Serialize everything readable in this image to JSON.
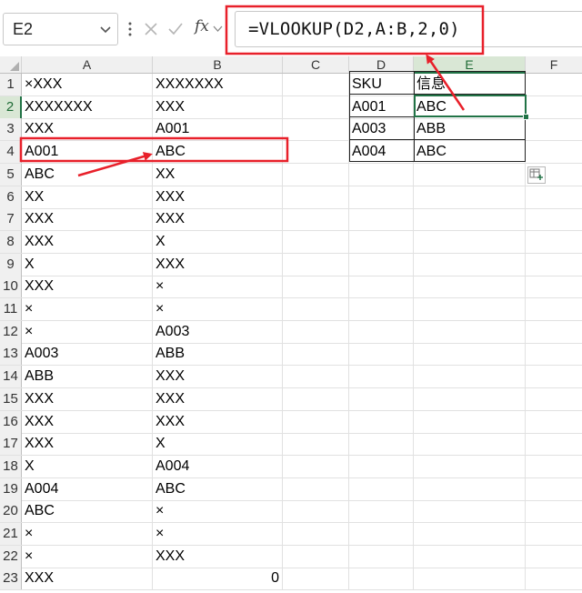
{
  "formula_bar": {
    "name_box": "E2",
    "fx_label": "fx",
    "formula": "=VLOOKUP(D2,A:B,2,0)"
  },
  "columns": [
    "A",
    "B",
    "C",
    "D",
    "E",
    "F"
  ],
  "selected_column": "E",
  "selected_row": "2",
  "rows": [
    {
      "num": "1",
      "a": "×XXX",
      "b": "XXXXXXX",
      "d": "SKU",
      "e": "信息"
    },
    {
      "num": "2",
      "a": "XXXXXXX",
      "b": "XXX",
      "d": "A001",
      "e": "ABC"
    },
    {
      "num": "3",
      "a": "XXX",
      "b": "A001",
      "d": "A003",
      "e": "ABB"
    },
    {
      "num": "4",
      "a": "A001",
      "b": "ABC",
      "d": "A004",
      "e": "ABC"
    },
    {
      "num": "5",
      "a": "ABC",
      "b": "XX"
    },
    {
      "num": "6",
      "a": "XX",
      "b": "XXX"
    },
    {
      "num": "7",
      "a": "XXX",
      "b": "XXX"
    },
    {
      "num": "8",
      "a": "XXX",
      "b": "X"
    },
    {
      "num": "9",
      "a": "X",
      "b": "XXX"
    },
    {
      "num": "10",
      "a": "XXX",
      "b": "×"
    },
    {
      "num": "11",
      "a": "×",
      "b": "×"
    },
    {
      "num": "12",
      "a": "×",
      "b": "A003"
    },
    {
      "num": "13",
      "a": "A003",
      "b": "ABB"
    },
    {
      "num": "14",
      "a": "ABB",
      "b": "XXX"
    },
    {
      "num": "15",
      "a": "XXX",
      "b": "XXX"
    },
    {
      "num": "16",
      "a": "XXX",
      "b": "XXX"
    },
    {
      "num": "17",
      "a": "XXX",
      "b": "X"
    },
    {
      "num": "18",
      "a": "X",
      "b": "A004"
    },
    {
      "num": "19",
      "a": "A004",
      "b": "ABC"
    },
    {
      "num": "20",
      "a": "ABC",
      "b": "×"
    },
    {
      "num": "21",
      "a": "×",
      "b": "×"
    },
    {
      "num": "22",
      "a": "×",
      "b": "XXX"
    },
    {
      "num": "23",
      "a": "XXX",
      "b": "0",
      "b_numeric": true
    }
  ],
  "colors": {
    "accent": "#217346",
    "annotation": "#e8202a",
    "header_bg": "#f0f0f0",
    "selected_header_bg": "#d9e7d5"
  }
}
